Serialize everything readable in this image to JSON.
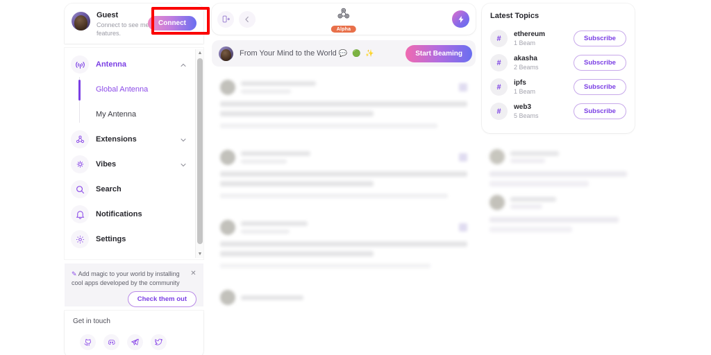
{
  "sidebar": {
    "profile": {
      "name": "Guest",
      "subtitle": "Connect to see member only features.",
      "connect_label": "Connect",
      "avatar_icon": "user-avatar"
    },
    "nav": [
      {
        "label": "Antenna",
        "icon": "antenna-icon",
        "active": true,
        "chevron": "chevron-up-icon"
      },
      {
        "label": "Extensions",
        "icon": "extensions-icon",
        "active": false,
        "chevron": "chevron-down-icon"
      },
      {
        "label": "Vibes",
        "icon": "vibes-icon",
        "active": false,
        "chevron": "chevron-down-icon"
      },
      {
        "label": "Search",
        "icon": "search-icon",
        "active": false,
        "chevron": ""
      },
      {
        "label": "Notifications",
        "icon": "bell-icon",
        "active": false,
        "chevron": ""
      },
      {
        "label": "Settings",
        "icon": "gear-icon",
        "active": false,
        "chevron": ""
      }
    ],
    "antenna_sub": [
      {
        "label": "Global Antenna",
        "active": true
      },
      {
        "label": "My Antenna",
        "active": false
      }
    ],
    "promo": {
      "spark": "✎",
      "text": "Add magic to your world by installing cool apps developed by the community",
      "button": "Check them out",
      "close_icon": "close-icon"
    },
    "footer": {
      "title": "Get in touch",
      "socials": [
        "github-icon",
        "discord-icon",
        "telegram-icon",
        "twitter-icon"
      ]
    },
    "scrollbar": {
      "up": "▲",
      "down": "▼"
    }
  },
  "topbar": {
    "sidebar_toggle_icon": "sidebar-toggle-icon",
    "back_icon": "chevron-left-icon",
    "logo_icon": "akasha-triskelion-logo",
    "badge": "Alpha",
    "action_icon": "lightning-bolt-icon"
  },
  "beam": {
    "avatar_icon": "user-avatar",
    "placeholder": "From Your Mind to the World",
    "emoji": "💬 🟢 ✨",
    "button": "Start Beaming"
  },
  "right_panel": {
    "title": "Latest Topics",
    "topics": [
      {
        "hash": "#",
        "name": "ethereum",
        "count": "1 Beam",
        "action": "Subscribe"
      },
      {
        "hash": "#",
        "name": "akasha",
        "count": "2 Beams",
        "action": "Subscribe"
      },
      {
        "hash": "#",
        "name": "ipfs",
        "count": "1 Beam",
        "action": "Subscribe"
      },
      {
        "hash": "#",
        "name": "web3",
        "count": "5 Beams",
        "action": "Subscribe"
      }
    ]
  },
  "annotation": {
    "highlight_target": "connect-button",
    "color": "#fb0000"
  },
  "colors": {
    "accent_purple": "#7b3fe4",
    "badge_orange": "#e8704a",
    "gradient_start": "#ee8bc4",
    "gradient_end": "#6a6ef0",
    "page_bg": "#ffffff"
  }
}
